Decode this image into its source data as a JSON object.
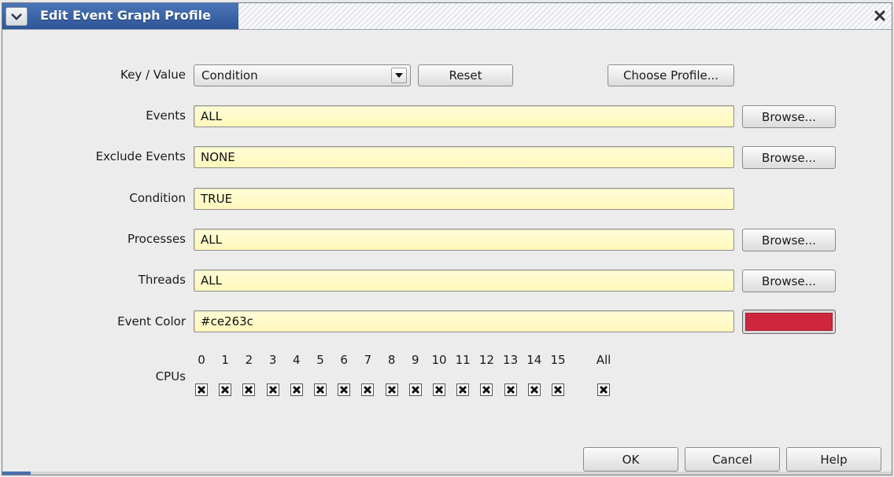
{
  "window": {
    "title": "Edit Event Graph Profile"
  },
  "form": {
    "key_value": {
      "label": "Key / Value",
      "selected": "Condition",
      "reset_label": "Reset",
      "choose_profile_label": "Choose Profile..."
    },
    "events": {
      "label": "Events",
      "value": "ALL",
      "browse_label": "Browse..."
    },
    "exclude_events": {
      "label": "Exclude Events",
      "value": "NONE",
      "browse_label": "Browse..."
    },
    "condition": {
      "label": "Condition",
      "value": "TRUE"
    },
    "processes": {
      "label": "Processes",
      "value": "ALL",
      "browse_label": "Browse..."
    },
    "threads": {
      "label": "Threads",
      "value": "ALL",
      "browse_label": "Browse..."
    },
    "event_color": {
      "label": "Event Color",
      "value": "#ce263c",
      "swatch_color": "#ce263c"
    }
  },
  "cpus": {
    "label": "CPUs",
    "items": [
      {
        "label": "0",
        "checked": true
      },
      {
        "label": "1",
        "checked": true
      },
      {
        "label": "2",
        "checked": true
      },
      {
        "label": "3",
        "checked": true
      },
      {
        "label": "4",
        "checked": true
      },
      {
        "label": "5",
        "checked": true
      },
      {
        "label": "6",
        "checked": true
      },
      {
        "label": "7",
        "checked": true
      },
      {
        "label": "8",
        "checked": true
      },
      {
        "label": "9",
        "checked": true
      },
      {
        "label": "10",
        "checked": true
      },
      {
        "label": "11",
        "checked": true
      },
      {
        "label": "12",
        "checked": true
      },
      {
        "label": "13",
        "checked": true
      },
      {
        "label": "14",
        "checked": true
      },
      {
        "label": "15",
        "checked": true
      }
    ],
    "all": {
      "label": "All",
      "checked": true
    }
  },
  "buttons": {
    "ok": "OK",
    "cancel": "Cancel",
    "help": "Help"
  },
  "colors": {
    "title_accent": "#2e5596",
    "field_background": "#fff7bb",
    "event_color": "#ce263c"
  }
}
